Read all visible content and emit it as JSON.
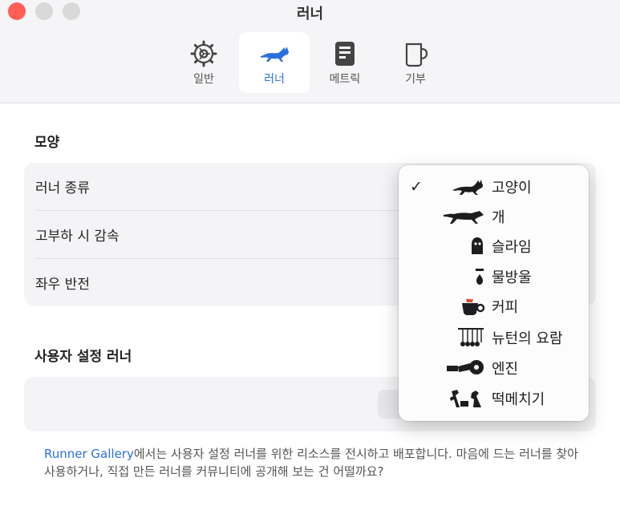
{
  "window": {
    "title": "러너"
  },
  "tabs": [
    {
      "id": "general",
      "label": "일반",
      "icon": "gear-icon"
    },
    {
      "id": "runner",
      "label": "러너",
      "icon": "cat-icon",
      "active": true
    },
    {
      "id": "metric",
      "label": "메트릭",
      "icon": "document-icon"
    },
    {
      "id": "donate",
      "label": "기부",
      "icon": "cup-icon"
    }
  ],
  "appearance": {
    "title": "모양",
    "rows": [
      {
        "label": "러너 종류"
      },
      {
        "label": "고부하 시 감속"
      },
      {
        "label": "좌우 반전"
      }
    ]
  },
  "custom": {
    "title": "사용자 설정 러너"
  },
  "footer": {
    "link": "Runner Gallery",
    "text": "에서는 사용자 설정 러너를 위한 리소스를 전시하고 배포합니다. 마음에 드는 러너를 찾아 사용하거나, 직접 만든 러너를 커뮤니티에 공개해 보는 건 어떨까요?"
  },
  "menu": {
    "check": "✓",
    "items": [
      {
        "label": "고양이",
        "icon": "cat-icon",
        "selected": true
      },
      {
        "label": "개",
        "icon": "dog-icon"
      },
      {
        "label": "슬라임",
        "icon": "slime-icon"
      },
      {
        "label": "물방울",
        "icon": "droplet-icon"
      },
      {
        "label": "커피",
        "icon": "coffee-icon"
      },
      {
        "label": "뉴턴의 요람",
        "icon": "newtons-cradle-icon"
      },
      {
        "label": "엔진",
        "icon": "engine-icon"
      },
      {
        "label": "떡메치기",
        "icon": "rice-cake-pounding-icon"
      }
    ]
  },
  "colors": {
    "accent": "#2a6fdc",
    "close": "#ff5f57"
  }
}
